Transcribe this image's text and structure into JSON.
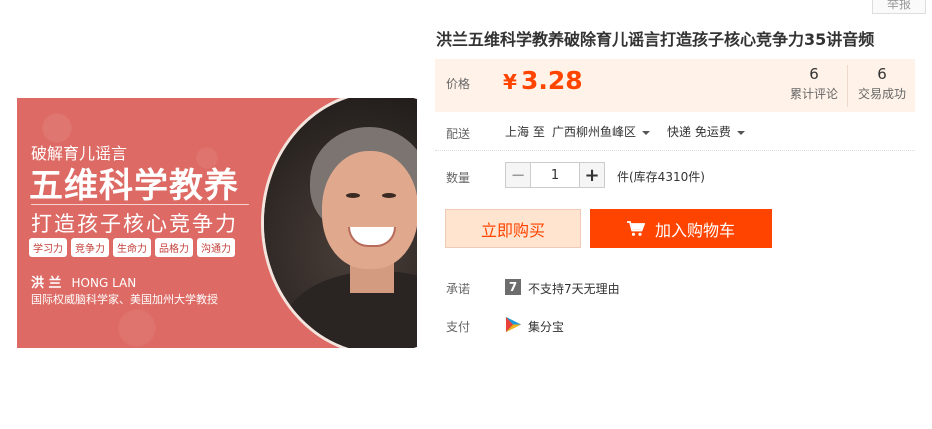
{
  "report": "举报",
  "image": {
    "line1": "破解育儿谣言",
    "line2": "五维科学教养",
    "line3": "打造孩子核心竞争力",
    "tags": [
      "学习力",
      "竞争力",
      "生命力",
      "品格力",
      "沟通力"
    ],
    "author_cn": "洪 兰",
    "author_en": "HONG LAN",
    "author_desc": "国际权威脑科学家、美国加州大学教授"
  },
  "product": {
    "title": "洪兰五维科学教养破除育儿谣言打造孩子核心竞争力35讲音频"
  },
  "price": {
    "label": "价格",
    "currency": "¥",
    "value": "3.28",
    "reviews_count": "6",
    "reviews_label": "累计评论",
    "sold_count": "6",
    "sold_label": "交易成功"
  },
  "shipping": {
    "label": "配送",
    "from": "上海 至",
    "to": "广西柳州鱼峰区",
    "method": "快递 免运费"
  },
  "quantity": {
    "label": "数量",
    "minus": "−",
    "value": "1",
    "plus": "+",
    "stock": "件(库存4310件)"
  },
  "actions": {
    "buy_now": "立即购买",
    "add_to_cart": "加入购物车"
  },
  "promise": {
    "label": "承诺",
    "icon_text": "7",
    "text": "不支持7天无理由"
  },
  "payment": {
    "label": "支付",
    "text": "集分宝"
  },
  "colors": {
    "accent": "#ff4400",
    "price_bg": "#fff2e8",
    "buy_now_bg": "#ffe4d0",
    "image_bg": "#dd6a64"
  }
}
